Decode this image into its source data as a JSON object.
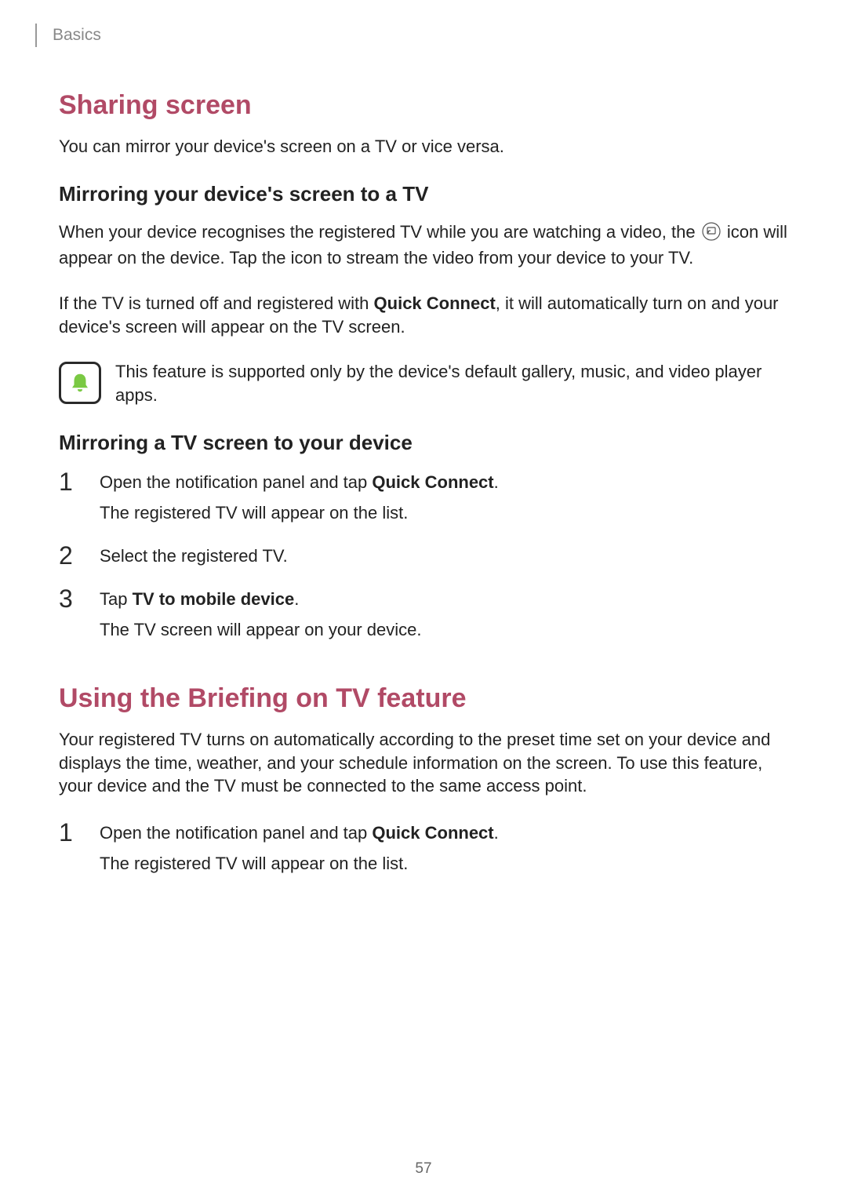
{
  "breadcrumb": "Basics",
  "section1": {
    "heading": "Sharing screen",
    "intro": "You can mirror your device's screen on a TV or vice versa.",
    "sub1_heading": "Mirroring your device's screen to a TV",
    "para1_a": "When your device recognises the registered TV while you are watching a video, the ",
    "para1_b": " icon will appear on the device. Tap the icon to stream the video from your device to your TV.",
    "para2_a": "If the TV is turned off and registered with ",
    "para2_bold": "Quick Connect",
    "para2_b": ", it will automatically turn on and your device's screen will appear on the TV screen.",
    "callout": "This feature is supported only by the device's default gallery, music, and video player apps.",
    "sub2_heading": "Mirroring a TV screen to your device",
    "steps": [
      {
        "num": "1",
        "line_a": "Open the notification panel and tap ",
        "line_bold": "Quick Connect",
        "line_b": ".",
        "sub": "The registered TV will appear on the list."
      },
      {
        "num": "2",
        "line_a": "Select the registered TV.",
        "line_bold": "",
        "line_b": "",
        "sub": ""
      },
      {
        "num": "3",
        "line_a": "Tap ",
        "line_bold": "TV to mobile device",
        "line_b": ".",
        "sub": "The TV screen will appear on your device."
      }
    ]
  },
  "section2": {
    "heading": "Using the Briefing on TV feature",
    "intro": "Your registered TV turns on automatically according to the preset time set on your device and displays the time, weather, and your schedule information on the screen. To use this feature, your device and the TV must be connected to the same access point.",
    "steps": [
      {
        "num": "1",
        "line_a": "Open the notification panel and tap ",
        "line_bold": "Quick Connect",
        "line_b": ".",
        "sub": "The registered TV will appear on the list."
      }
    ]
  },
  "page_number": "57"
}
